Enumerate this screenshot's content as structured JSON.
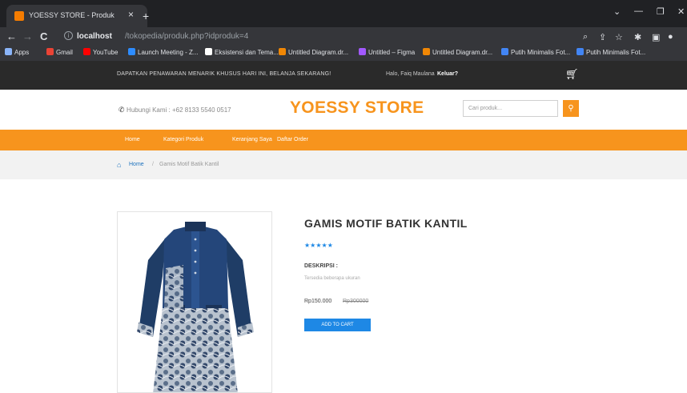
{
  "browser": {
    "tab_title": "YOESSY STORE - Produk",
    "tab_close": "×",
    "new_tab": "+",
    "url_host": "localhost",
    "url_path": "/tokopedia/produk.php?idproduk=4",
    "bookmarks": [
      {
        "label": "Apps",
        "color": "#8ab4f8"
      },
      {
        "label": "Gmail",
        "color": "#ea4335"
      },
      {
        "label": "YouTube",
        "color": "#ff0000"
      },
      {
        "label": "Launch Meeting - Z...",
        "color": "#2d8cff"
      },
      {
        "label": "Eksistensi dan Tema...",
        "color": "#ffffff"
      },
      {
        "label": "Untitled Diagram.dr...",
        "color": "#f08705"
      },
      {
        "label": "Untitled – Figma",
        "color": "#a259ff"
      },
      {
        "label": "Untitled Diagram.dr...",
        "color": "#f08705"
      },
      {
        "label": "Putih Minimalis Fot...",
        "color": "#4285f4"
      },
      {
        "label": "Putih Minimalis Fot...",
        "color": "#4285f4"
      }
    ]
  },
  "promo": {
    "text": "DAPATKAN PENAWARAN MENARIK KHUSUS HARI INI, BELANJA SEKARANG!",
    "greeting": "Halo, Faiq Maulana",
    "logout": "Keluar?"
  },
  "header": {
    "phone": "Hubungi Kami : +62 8133 5540 0517",
    "logo": "YOESSY STORE",
    "search_placeholder": "Cari produk..."
  },
  "menu": [
    "Home",
    "Kategori Produk",
    "Keranjang Saya",
    "Daftar Order"
  ],
  "breadcrumb": {
    "home": "Home",
    "separator": "/",
    "current": "Gamis Motif Batik Kantil"
  },
  "product": {
    "title": "GAMIS MOTIF BATIK KANTIL",
    "rating": 5,
    "stars_text": "★★★★★",
    "desc_label": "DESKRIPSI :",
    "desc_text": "Tersedia beberapa ukuran",
    "price": "Rp150.000",
    "old_price": "Rp300000",
    "add_to_cart": "ADD TO CART"
  },
  "colors": {
    "accent": "#f7941d",
    "dark_bar": "#2a2a2a",
    "link_blue": "#1e73be",
    "button_blue": "#1e88e5"
  }
}
